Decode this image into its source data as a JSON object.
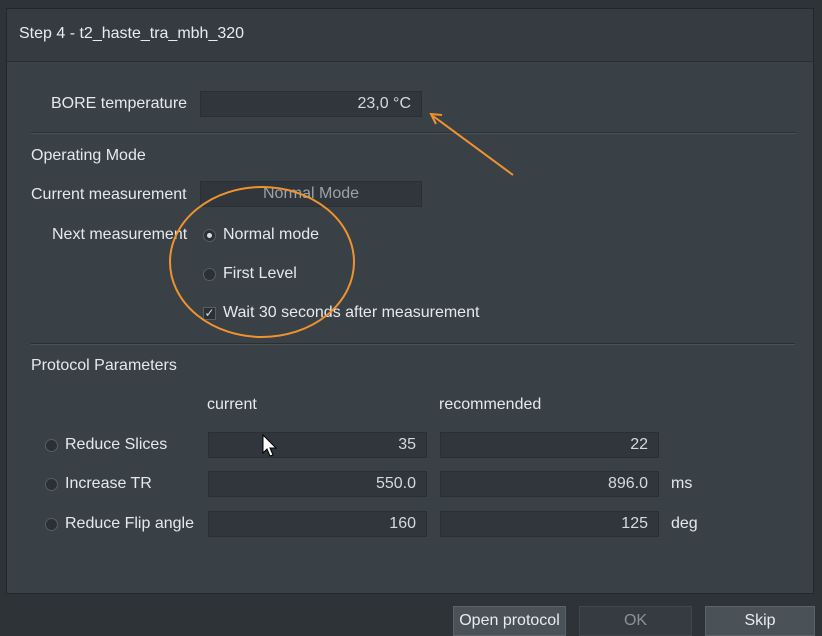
{
  "title": "Step 4 - t2_haste_tra_mbh_320",
  "bore": {
    "label": "BORE temperature",
    "value": "23,0 °C"
  },
  "operating_mode": {
    "heading": "Operating Mode",
    "current_label": "Current measurement",
    "current_value": "Normal Mode",
    "next_label": "Next measurement",
    "options": [
      "Normal mode",
      "First Level"
    ],
    "selected_option": "Normal mode",
    "wait_label": "Wait 30 seconds after measurement",
    "wait_checked": true
  },
  "protocol": {
    "heading": "Protocol Parameters",
    "col_current": "current",
    "col_recommended": "recommended",
    "rows": [
      {
        "label": "Reduce Slices",
        "current": "35",
        "recommended": "22",
        "unit": ""
      },
      {
        "label": "Increase TR",
        "current": "550.0",
        "recommended": "896.0",
        "unit": "ms"
      },
      {
        "label": "Reduce Flip angle",
        "current": "160",
        "recommended": "125",
        "unit": "deg"
      }
    ]
  },
  "buttons": {
    "open_protocol": "Open protocol",
    "ok": "OK",
    "skip": "Skip"
  },
  "colors": {
    "annotation": "#f0932e",
    "background": "#394046"
  }
}
